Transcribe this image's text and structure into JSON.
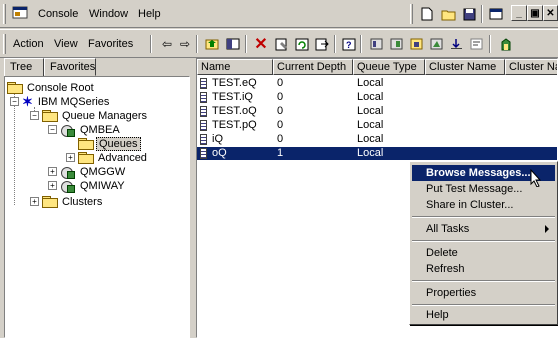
{
  "menubar": {
    "items": [
      {
        "label": "Console"
      },
      {
        "label": "Window"
      },
      {
        "label": "Help"
      }
    ]
  },
  "toolbar": {
    "items": [
      {
        "label": "Action"
      },
      {
        "label": "View"
      },
      {
        "label": "Favorites"
      }
    ]
  },
  "left_tabs": [
    {
      "label": "Tree"
    },
    {
      "label": "Favorites"
    }
  ],
  "tree": {
    "root": "Console Root",
    "ibm": "IBM MQSeries",
    "queue_managers": "Queue Managers",
    "qmbea": "QMBEA",
    "queues": "Queues",
    "advanced": "Advanced",
    "qmggw": "QMGGW",
    "qmiway": "QMIWAY",
    "clusters": "Clusters"
  },
  "list": {
    "columns": [
      "Name",
      "Current Depth",
      "Queue Type",
      "Cluster Name",
      "Cluster Na"
    ],
    "rows": [
      {
        "name": "TEST.eQ",
        "depth": "0",
        "type": "Local"
      },
      {
        "name": "TEST.iQ",
        "depth": "0",
        "type": "Local"
      },
      {
        "name": "TEST.oQ",
        "depth": "0",
        "type": "Local"
      },
      {
        "name": "TEST.pQ",
        "depth": "0",
        "type": "Local"
      },
      {
        "name": "iQ",
        "depth": "0",
        "type": "Local"
      },
      {
        "name": "oQ",
        "depth": "1",
        "type": "Local"
      }
    ]
  },
  "context_menu": {
    "browse": "Browse Messages...",
    "put_test": "Put Test Message...",
    "share": "Share in Cluster...",
    "all_tasks": "All Tasks",
    "delete": "Delete",
    "refresh": "Refresh",
    "properties": "Properties",
    "help": "Help"
  },
  "colors": {
    "selection": "#0a246a",
    "face": "#d4d0c8"
  }
}
